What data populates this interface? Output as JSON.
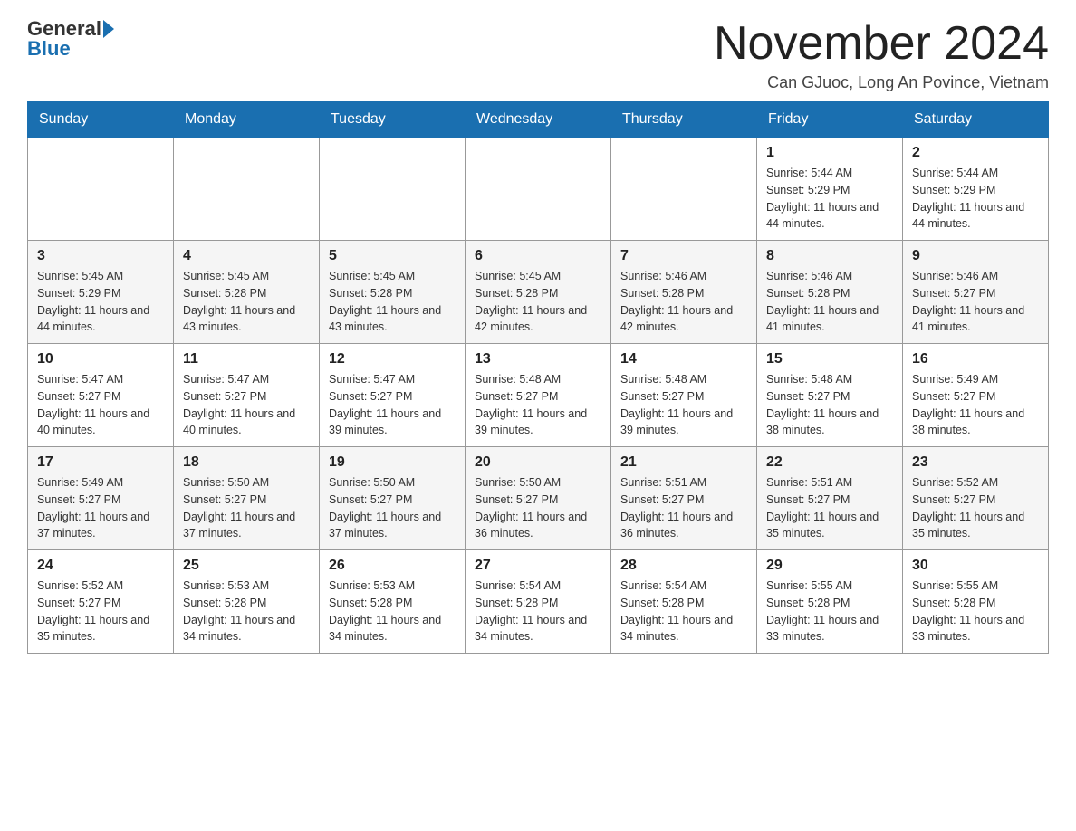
{
  "header": {
    "logo_general": "General",
    "logo_blue": "Blue",
    "month_title": "November 2024",
    "subtitle": "Can GJuoc, Long An Povince, Vietnam"
  },
  "calendar": {
    "days_of_week": [
      "Sunday",
      "Monday",
      "Tuesday",
      "Wednesday",
      "Thursday",
      "Friday",
      "Saturday"
    ],
    "weeks": [
      [
        {
          "day": "",
          "info": ""
        },
        {
          "day": "",
          "info": ""
        },
        {
          "day": "",
          "info": ""
        },
        {
          "day": "",
          "info": ""
        },
        {
          "day": "",
          "info": ""
        },
        {
          "day": "1",
          "info": "Sunrise: 5:44 AM\nSunset: 5:29 PM\nDaylight: 11 hours and 44 minutes."
        },
        {
          "day": "2",
          "info": "Sunrise: 5:44 AM\nSunset: 5:29 PM\nDaylight: 11 hours and 44 minutes."
        }
      ],
      [
        {
          "day": "3",
          "info": "Sunrise: 5:45 AM\nSunset: 5:29 PM\nDaylight: 11 hours and 44 minutes."
        },
        {
          "day": "4",
          "info": "Sunrise: 5:45 AM\nSunset: 5:28 PM\nDaylight: 11 hours and 43 minutes."
        },
        {
          "day": "5",
          "info": "Sunrise: 5:45 AM\nSunset: 5:28 PM\nDaylight: 11 hours and 43 minutes."
        },
        {
          "day": "6",
          "info": "Sunrise: 5:45 AM\nSunset: 5:28 PM\nDaylight: 11 hours and 42 minutes."
        },
        {
          "day": "7",
          "info": "Sunrise: 5:46 AM\nSunset: 5:28 PM\nDaylight: 11 hours and 42 minutes."
        },
        {
          "day": "8",
          "info": "Sunrise: 5:46 AM\nSunset: 5:28 PM\nDaylight: 11 hours and 41 minutes."
        },
        {
          "day": "9",
          "info": "Sunrise: 5:46 AM\nSunset: 5:27 PM\nDaylight: 11 hours and 41 minutes."
        }
      ],
      [
        {
          "day": "10",
          "info": "Sunrise: 5:47 AM\nSunset: 5:27 PM\nDaylight: 11 hours and 40 minutes."
        },
        {
          "day": "11",
          "info": "Sunrise: 5:47 AM\nSunset: 5:27 PM\nDaylight: 11 hours and 40 minutes."
        },
        {
          "day": "12",
          "info": "Sunrise: 5:47 AM\nSunset: 5:27 PM\nDaylight: 11 hours and 39 minutes."
        },
        {
          "day": "13",
          "info": "Sunrise: 5:48 AM\nSunset: 5:27 PM\nDaylight: 11 hours and 39 minutes."
        },
        {
          "day": "14",
          "info": "Sunrise: 5:48 AM\nSunset: 5:27 PM\nDaylight: 11 hours and 39 minutes."
        },
        {
          "day": "15",
          "info": "Sunrise: 5:48 AM\nSunset: 5:27 PM\nDaylight: 11 hours and 38 minutes."
        },
        {
          "day": "16",
          "info": "Sunrise: 5:49 AM\nSunset: 5:27 PM\nDaylight: 11 hours and 38 minutes."
        }
      ],
      [
        {
          "day": "17",
          "info": "Sunrise: 5:49 AM\nSunset: 5:27 PM\nDaylight: 11 hours and 37 minutes."
        },
        {
          "day": "18",
          "info": "Sunrise: 5:50 AM\nSunset: 5:27 PM\nDaylight: 11 hours and 37 minutes."
        },
        {
          "day": "19",
          "info": "Sunrise: 5:50 AM\nSunset: 5:27 PM\nDaylight: 11 hours and 37 minutes."
        },
        {
          "day": "20",
          "info": "Sunrise: 5:50 AM\nSunset: 5:27 PM\nDaylight: 11 hours and 36 minutes."
        },
        {
          "day": "21",
          "info": "Sunrise: 5:51 AM\nSunset: 5:27 PM\nDaylight: 11 hours and 36 minutes."
        },
        {
          "day": "22",
          "info": "Sunrise: 5:51 AM\nSunset: 5:27 PM\nDaylight: 11 hours and 35 minutes."
        },
        {
          "day": "23",
          "info": "Sunrise: 5:52 AM\nSunset: 5:27 PM\nDaylight: 11 hours and 35 minutes."
        }
      ],
      [
        {
          "day": "24",
          "info": "Sunrise: 5:52 AM\nSunset: 5:27 PM\nDaylight: 11 hours and 35 minutes."
        },
        {
          "day": "25",
          "info": "Sunrise: 5:53 AM\nSunset: 5:28 PM\nDaylight: 11 hours and 34 minutes."
        },
        {
          "day": "26",
          "info": "Sunrise: 5:53 AM\nSunset: 5:28 PM\nDaylight: 11 hours and 34 minutes."
        },
        {
          "day": "27",
          "info": "Sunrise: 5:54 AM\nSunset: 5:28 PM\nDaylight: 11 hours and 34 minutes."
        },
        {
          "day": "28",
          "info": "Sunrise: 5:54 AM\nSunset: 5:28 PM\nDaylight: 11 hours and 34 minutes."
        },
        {
          "day": "29",
          "info": "Sunrise: 5:55 AM\nSunset: 5:28 PM\nDaylight: 11 hours and 33 minutes."
        },
        {
          "day": "30",
          "info": "Sunrise: 5:55 AM\nSunset: 5:28 PM\nDaylight: 11 hours and 33 minutes."
        }
      ]
    ]
  }
}
